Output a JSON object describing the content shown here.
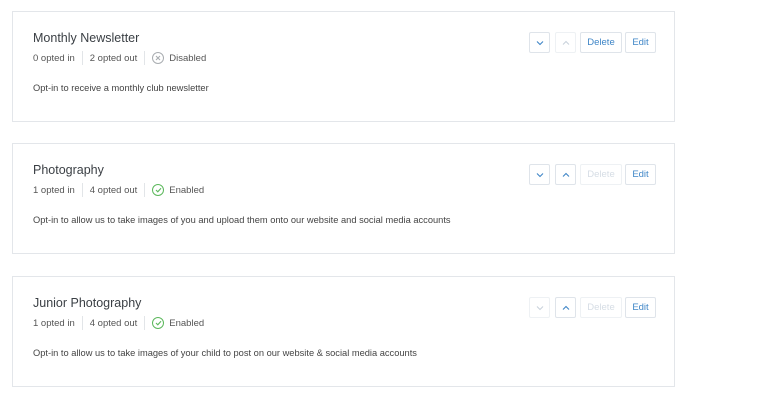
{
  "cards": [
    {
      "title": "Monthly Newsletter",
      "opted_in": "0 opted in",
      "opted_out": "2 opted out",
      "status": "Disabled",
      "description": "Opt-in to receive a monthly club newsletter",
      "delete_label": "Delete",
      "edit_label": "Edit"
    },
    {
      "title": "Photography",
      "opted_in": "1 opted in",
      "opted_out": "4 opted out",
      "status": "Enabled",
      "description": "Opt-in to allow us to take images of you and upload them onto our website and social media accounts",
      "delete_label": "Delete",
      "edit_label": "Edit"
    },
    {
      "title": "Junior Photography",
      "opted_in": "1 opted in",
      "opted_out": "4 opted out",
      "status": "Enabled",
      "description": "Opt-in to allow us to take images of your child to post on our website & social media accounts",
      "delete_label": "Delete",
      "edit_label": "Edit"
    }
  ],
  "colors": {
    "accent": "#3f86c7",
    "enabled": "#5cb85c",
    "disabled": "#a9adb1",
    "border": "#e3e6ea"
  },
  "icons": [
    "chevron-down-icon",
    "chevron-up-icon",
    "x-circle-icon",
    "check-circle-icon"
  ]
}
